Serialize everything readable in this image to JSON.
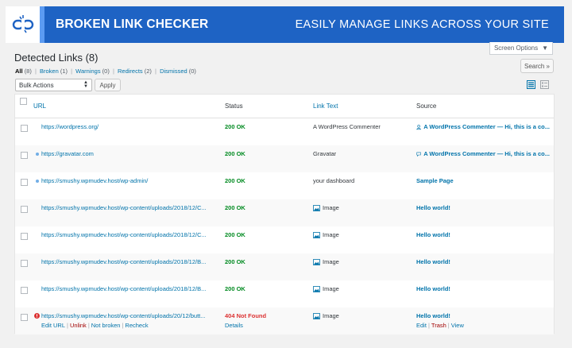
{
  "header": {
    "brand": "BROKEN LINK CHECKER",
    "tagline": "EASILY MANAGE LINKS ACROSS YOUR SITE"
  },
  "screen_options": "Screen Options",
  "page_title": "Detected Links (8)",
  "filters": [
    {
      "label": "All",
      "count": "(8)"
    },
    {
      "label": "Broken",
      "count": "(1)"
    },
    {
      "label": "Warnings",
      "count": "(0)"
    },
    {
      "label": "Redirects",
      "count": "(2)"
    },
    {
      "label": "Dismissed",
      "count": "(0)"
    }
  ],
  "search_button": "Search »",
  "bulk_actions": "Bulk Actions",
  "apply_button": "Apply",
  "columns": {
    "url": "URL",
    "status": "Status",
    "link_text": "Link Text",
    "source": "Source"
  },
  "rows": [
    {
      "url": "https://wordpress.org/",
      "status": "200 OK",
      "link_text": "A WordPress Commenter",
      "source": "A WordPress Commenter — Hi, this is a co..."
    },
    {
      "url": "https://gravatar.com",
      "status": "200 OK",
      "link_text": "Gravatar",
      "source": "A WordPress Commenter — Hi, this is a co..."
    },
    {
      "url": "https://smushy.wpmudev.host/wp-admin/",
      "status": "200 OK",
      "link_text": "your dashboard",
      "source": "Sample Page"
    },
    {
      "url": "https://smushy.wpmudev.host/wp-content/uploads/2018/12/C...",
      "status": "200 OK",
      "link_text": "Image",
      "source": "Hello world!"
    },
    {
      "url": "https://smushy.wpmudev.host/wp-content/uploads/2018/12/C...",
      "status": "200 OK",
      "link_text": "Image",
      "source": "Hello world!"
    },
    {
      "url": "https://smushy.wpmudev.host/wp-content/uploads/2018/12/B...",
      "status": "200 OK",
      "link_text": "Image",
      "source": "Hello world!"
    },
    {
      "url": "https://smushy.wpmudev.host/wp-content/uploads/2018/12/B...",
      "status": "200 OK",
      "link_text": "Image",
      "source": "Hello world!"
    },
    {
      "url": "https://smushy.wpmudev.host/wp-content/uploads/20/12/butt...",
      "status": "404 Not Found",
      "link_text": "Image",
      "source": "Hello world!"
    }
  ],
  "row_actions": {
    "url": [
      "Edit URL",
      "Unlink",
      "Not broken",
      "Recheck"
    ],
    "status": "Details",
    "source": [
      "Edit",
      "Trash",
      "View"
    ]
  },
  "colors": {
    "banner": "#1e63c4",
    "ok": "#008a20",
    "error": "#dc3232",
    "link": "#0073aa"
  }
}
